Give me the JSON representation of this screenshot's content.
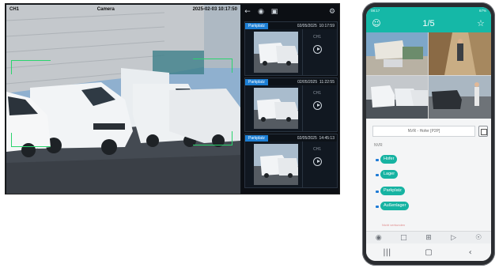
{
  "desktop": {
    "live_view": {
      "channel": "CH1",
      "camera_name": "Camera",
      "datetime": "2025-02-03 10:17:50"
    },
    "toolbar_icons": [
      "back-icon",
      "eye-icon",
      "image-icon",
      "gear-icon"
    ],
    "events": [
      {
        "tag": "Parkplatz",
        "date": "02/05/2025",
        "time": "10:17:59",
        "channel": "CH1"
      },
      {
        "tag": "Parkplatz",
        "date": "02/05/2025",
        "time": "11:22:55",
        "channel": "CH1"
      },
      {
        "tag": "Parkplatz",
        "date": "02/05/2025",
        "time": "14:45:13",
        "channel": "CH1"
      }
    ],
    "colors": {
      "accent_blue": "#1d7fd4",
      "detection_box": "#2bd46e",
      "panel_bg": "#0c0f14"
    }
  },
  "phone": {
    "status_bar": {
      "time": "08:17",
      "battery": "67%"
    },
    "header": {
      "page_indicator": "1/5",
      "left_icon": "user-icon",
      "right_icon": "star-icon"
    },
    "device_selector": "NVR - Hofer [P2P]",
    "group_label": "NVR",
    "channels": [
      "Hofer",
      "Lager",
      "Parkplatz",
      "Außenlager"
    ],
    "disabled_item": "Nicht verbunden",
    "bottom_toolbar": [
      "camera-icon",
      "folder-icon",
      "grid-icon",
      "speaker-icon",
      "microphone-icon"
    ],
    "nav_buttons": [
      "recent-apps-icon",
      "home-icon",
      "back-icon"
    ],
    "colors": {
      "header_teal": "#15b8a7",
      "chip_teal": "#16b3a2"
    }
  }
}
